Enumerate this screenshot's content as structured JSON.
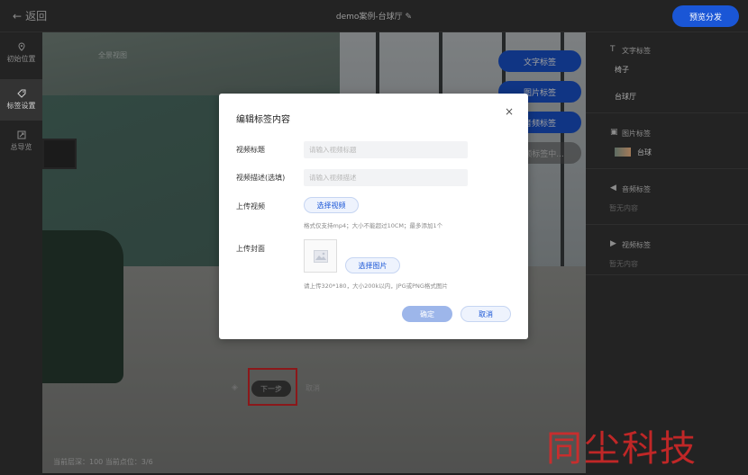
{
  "topbar": {
    "back_label": "返回",
    "title": "demo案例-台球厅",
    "preview_label": "预览分发"
  },
  "sidebar": {
    "items": [
      {
        "label": "初始位置",
        "icon": "location-pin-icon"
      },
      {
        "label": "标签设置",
        "icon": "tag-icon"
      },
      {
        "label": "总导览",
        "icon": "expand-icon"
      }
    ]
  },
  "scene": {
    "panorama_label": "全景视图",
    "buttons": {
      "text_tag": "文字标签",
      "image_tag": "图片标签",
      "audio_tag": "音频标签",
      "video_tag": "视频标签中..."
    },
    "next_label": "下一步",
    "cancel_label": "取消",
    "status": "当前层深：100  当前点位：3/6"
  },
  "right_panel": {
    "text_section": {
      "title": "文字标签",
      "items": [
        "椅子",
        "台球厅"
      ]
    },
    "image_section": {
      "title": "图片标签",
      "items": [
        "台球"
      ]
    },
    "audio_section": {
      "title": "音频标签",
      "empty": "暂无内容"
    },
    "video_section": {
      "title": "视频标签",
      "empty": "暂无内容"
    }
  },
  "dialog": {
    "title": "编辑标签内容",
    "video_title_label": "视频标题",
    "video_title_placeholder": "请输入视频标题",
    "video_desc_label": "视频描述(选填)",
    "video_desc_placeholder": "请输入视频描述",
    "upload_video_label": "上传视频",
    "select_video_label": "选择视频",
    "video_hint": "格式仅支持mp4；大小不能超过10CM；最多添加1个",
    "upload_cover_label": "上传封面",
    "select_image_label": "选择图片",
    "cover_hint": "请上传320*180，大小200k以内，JPG或PNG格式图片",
    "confirm_label": "确定",
    "cancel_label": "取消"
  },
  "watermark": "同尘科技",
  "colors": {
    "accent": "#1a56d6",
    "highlight": "#e0282a"
  }
}
